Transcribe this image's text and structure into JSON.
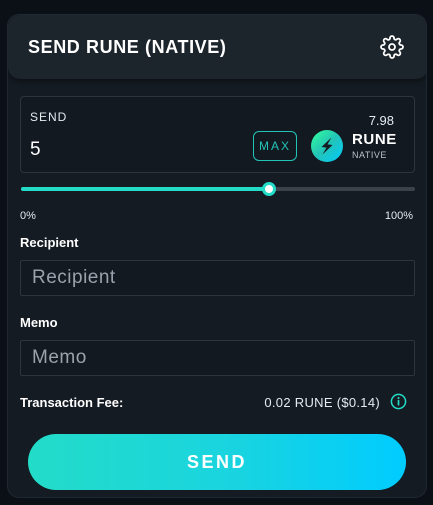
{
  "header": {
    "title": "SEND RUNE (NATIVE)",
    "settings_icon": "gear-icon"
  },
  "amount": {
    "label": "SEND",
    "value": "5",
    "balance": "7.98",
    "max_label": "MAX",
    "asset": {
      "ticker": "RUNE",
      "network": "NATIVE",
      "logo_icon": "thorchain-logo"
    }
  },
  "slider": {
    "percent": 63,
    "min_label": "0%",
    "max_label": "100%"
  },
  "recipient": {
    "label": "Recipient",
    "placeholder": "Recipient",
    "value": ""
  },
  "memo": {
    "label": "Memo",
    "placeholder": "Memo",
    "value": ""
  },
  "fee": {
    "label": "Transaction Fee:",
    "value": "0.02 RUNE ($0.14)",
    "info_icon": "info-icon"
  },
  "send_button": {
    "label": "SEND"
  },
  "colors": {
    "accent": "#23dcc8",
    "accent_gradient_end": "#00ccff",
    "card_background": "#141b22",
    "header_background": "#1c242c"
  }
}
